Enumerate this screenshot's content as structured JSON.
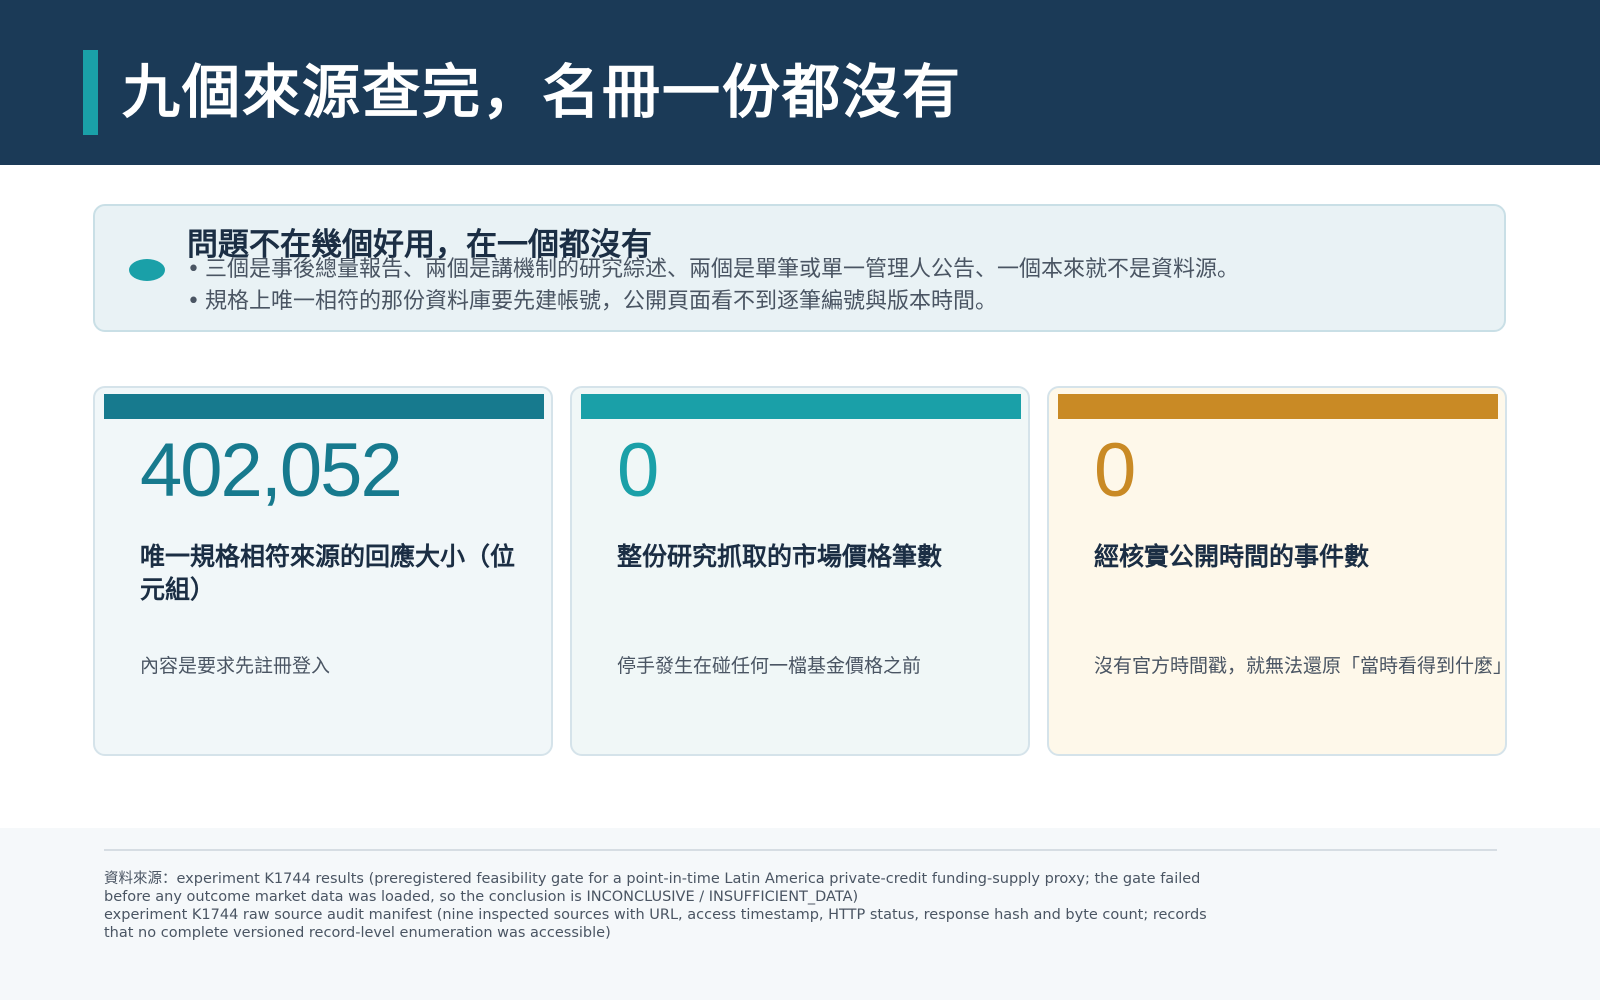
{
  "header": {
    "title": "九個來源查完，名冊一份都沒有",
    "accent_color": "#1aa0a8",
    "background_color": "#1b3a57"
  },
  "summary": {
    "heading": "問題不在幾個好用，在一個都沒有",
    "bullets": [
      "三個是事後總量報告、兩個是講機制的研究綜述、兩個是單筆或單一管理人公告、一個本來就不是資料源。",
      "規格上唯一相符的那份資料庫要先建帳號，公開頁面看不到逐筆編號與版本時間。"
    ]
  },
  "cards": [
    {
      "value": "402,052",
      "label": "唯一規格相符來源的回應大小（位元組）",
      "note": "內容是要求先註冊登入",
      "accent_color": "#177a8e"
    },
    {
      "value": "0",
      "label": "整份研究抓取的市場價格筆數",
      "note": "停手發生在碰任何一檔基金價格之前",
      "accent_color": "#1aa0a8"
    },
    {
      "value": "0",
      "label": "經核實公開時間的事件數",
      "note": "沒有官方時間戳，就無法還原「當時看得到什麼」",
      "accent_color": "#c98a25"
    }
  ],
  "footer": {
    "source_line_1": "資料來源：experiment K1744 results (preregistered feasibility gate for a point-in-time Latin America private-credit funding-supply proxy; the gate failed before any outcome market data was loaded, so the conclusion is INCONCLUSIVE / INSUFFICIENT_DATA)",
    "source_line_2": "experiment K1744 raw source audit manifest (nine inspected sources with URL, access timestamp, HTTP status, response hash and byte count; records that no complete versioned record-level enumeration was accessible)"
  }
}
